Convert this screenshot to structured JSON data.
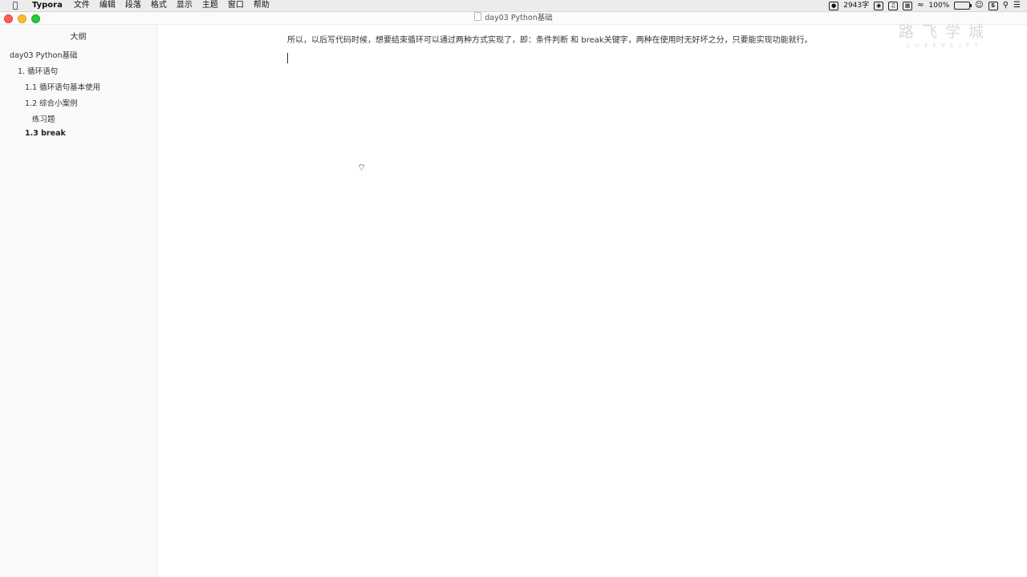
{
  "menubar": {
    "app_name": "Typora",
    "items": [
      "文件",
      "编辑",
      "段落",
      "格式",
      "显示",
      "主题",
      "窗口",
      "帮助"
    ],
    "status": {
      "word_count": "2943字",
      "battery": "100%"
    },
    "icons": [
      "apple-icon",
      "screen-record-icon",
      "app-indicator-icon",
      "mic-icon",
      "grid-icon",
      "wifi-icon",
      "battery-icon",
      "user-icon",
      "s-app-icon",
      "search-icon",
      "control-center-icon"
    ]
  },
  "window": {
    "title": "day03 Python基础"
  },
  "sidebar": {
    "title": "大纲",
    "items": [
      {
        "label": "day03 Python基础",
        "level": 0,
        "active": false
      },
      {
        "label": "1. 循环语句",
        "level": 1,
        "active": false
      },
      {
        "label": "1.1 循环语句基本使用",
        "level": 2,
        "active": false
      },
      {
        "label": "1.2 综合小案例",
        "level": 2,
        "active": false
      },
      {
        "label": "练习题",
        "level": 3,
        "active": false
      },
      {
        "label": "1.3 break",
        "level": 2,
        "active": true
      }
    ]
  },
  "editor": {
    "paragraph": "所以，以后写代码时候，想要结束循环可以通过两种方式实现了，即：条件判断 和 break关键字，两种在使用时无好坏之分，只要能实现功能就行。"
  },
  "watermark": {
    "cn": "路飞学城",
    "en": "LUFFYCITY"
  }
}
